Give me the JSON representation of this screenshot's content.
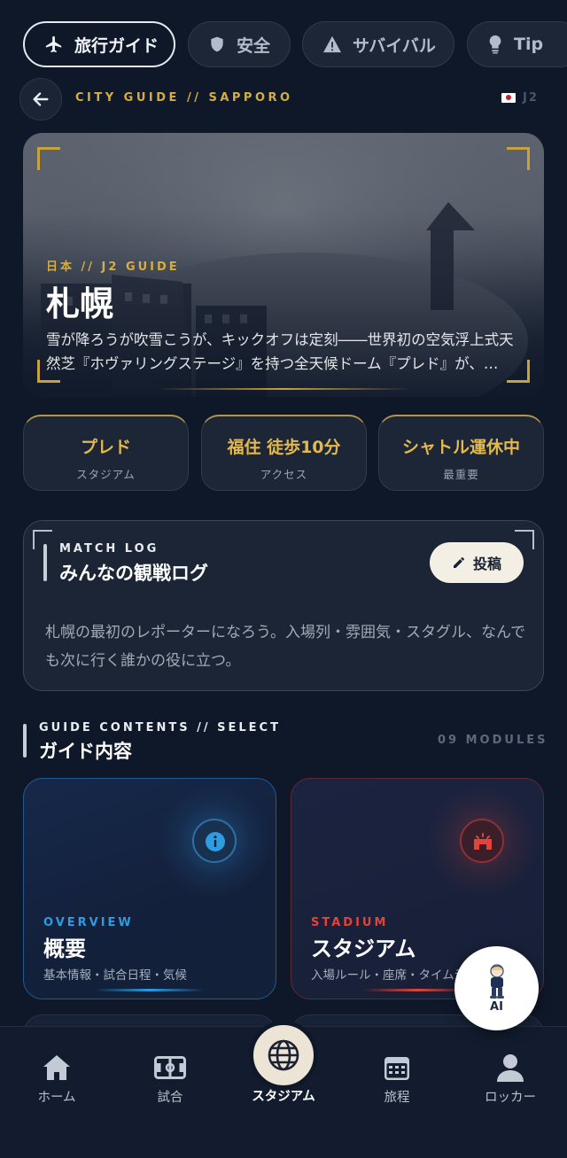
{
  "chips": [
    {
      "label": "旅行ガイド",
      "icon": "airplane-icon",
      "active": true
    },
    {
      "label": "安全",
      "icon": "shield-icon",
      "active": false
    },
    {
      "label": "サバイバル",
      "icon": "warning-icon",
      "active": false
    },
    {
      "label": "Tip",
      "icon": "lightbulb-icon",
      "active": false
    }
  ],
  "breadcrumb": {
    "path": "CITY GUIDE // SAPPORO",
    "right": "J2"
  },
  "hero": {
    "kicker": "日本 // J2 GUIDE",
    "title": "札幌",
    "description": "雪が降ろうが吹雪こうが、キックオフは定刻――世界初の空気浮上式天然芝『ホヴァリングステージ』を持つ全天候ドーム『プレド』が、…"
  },
  "info_cards": [
    {
      "value": "プレド",
      "label": "スタジアム"
    },
    {
      "value": "福住 徒歩10分",
      "label": "アクセス"
    },
    {
      "value": "シャトル運休中",
      "label": "最重要"
    }
  ],
  "match_log": {
    "kicker": "MATCH LOG",
    "title": "みんなの観戦ログ",
    "post_label": "投稿",
    "body": "札幌の最初のレポーターになろう。入場列・雰囲気・スタグル、なんでも次に行く誰かの役に立つ。"
  },
  "guide": {
    "kicker": "GUIDE CONTENTS // SELECT",
    "title": "ガイド内容",
    "count": "09 MODULES",
    "modules": [
      {
        "kicker": "OVERVIEW",
        "title": "概要",
        "subtitle": "基本情報・試合日程・気候",
        "color": "#2f9be0",
        "icon": "info-icon"
      },
      {
        "kicker": "STADIUM",
        "title": "スタジアム",
        "subtitle": "入場ルール・座席・タイムライン",
        "color": "#e0453c",
        "icon": "stadium-icon"
      }
    ]
  },
  "ai_button": {
    "label": "AI"
  },
  "nav": [
    {
      "label": "ホーム",
      "icon": "home-icon"
    },
    {
      "label": "試合",
      "icon": "pitch-icon"
    },
    {
      "label": "スタジアム",
      "icon": "globe-icon",
      "active": true
    },
    {
      "label": "旅程",
      "icon": "calendar-icon"
    },
    {
      "label": "ロッカー",
      "icon": "user-icon"
    }
  ]
}
